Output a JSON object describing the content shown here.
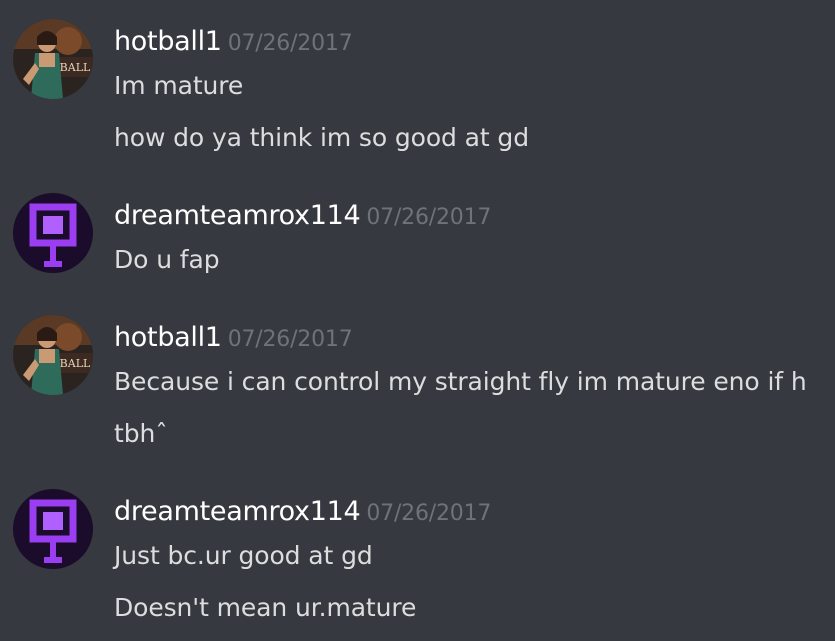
{
  "messages": [
    {
      "username": "hotball1",
      "timestamp": "07/26/2017",
      "avatar": "game-character-avatar",
      "lines": [
        "Im mature",
        "how do ya think im so good at gd"
      ]
    },
    {
      "username": "dreamteamrox114",
      "timestamp": "07/26/2017",
      "avatar": "purple-block-avatar",
      "lines": [
        "Do u fap"
      ]
    },
    {
      "username": "hotball1",
      "timestamp": "07/26/2017",
      "avatar": "game-character-avatar",
      "lines": [
        "Because i can control my straight fly im mature eno if h",
        "tbhˆ"
      ]
    },
    {
      "username": "dreamteamrox114",
      "timestamp": "07/26/2017",
      "avatar": "purple-block-avatar",
      "lines": [
        "Just bc.ur good at gd",
        "Doesn't mean ur.mature"
      ]
    }
  ],
  "colors": {
    "background": "#36393f",
    "username": "#ffffff",
    "timestamp": "#6f7278",
    "message_text": "#dcddde",
    "purple_avatar": "#8a2be2"
  }
}
